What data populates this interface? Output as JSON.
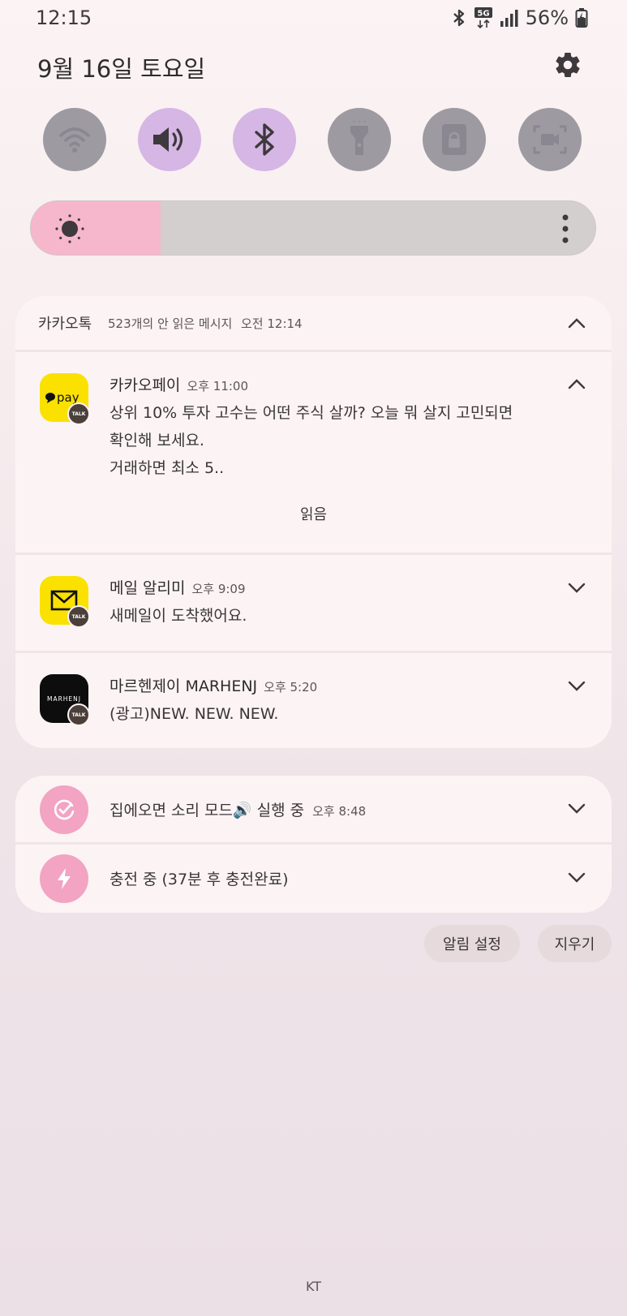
{
  "status_bar": {
    "time": "12:15",
    "network": "5G",
    "battery": "56%"
  },
  "header": {
    "date": "9월 16일 토요일"
  },
  "quick_settings": [
    {
      "name": "wifi",
      "active": false
    },
    {
      "name": "sound",
      "active": true
    },
    {
      "name": "bluetooth",
      "active": true
    },
    {
      "name": "flashlight",
      "active": false
    },
    {
      "name": "rotation-lock",
      "active": false
    },
    {
      "name": "screen-recorder",
      "active": false
    }
  ],
  "brightness": {
    "level": 0.23
  },
  "kakao_group": {
    "app_name": "카카오톡",
    "unread": "523개의 안 읽은 메시지",
    "time": "오전 12:14",
    "notifications": [
      {
        "title": "카카오페이",
        "time": "오후 11:00",
        "lines": [
          "상위 10% 투자 고수는 어떤 주식 살까? 오늘 뭐 살지 고민되면",
          "확인해 보세요.",
          "거래하면 최소 5.."
        ],
        "icon_text": "pay",
        "action": "읽음"
      },
      {
        "title": "메일 알리미",
        "time": "오후 9:09",
        "lines": [
          "새메일이 도착했어요."
        ]
      },
      {
        "title": "마르헨제이 MARHENJ",
        "time": "오후 5:20",
        "lines": [
          "(광고)NEW. NEW. NEW."
        ],
        "icon_text": "MARHENJ"
      }
    ],
    "badge_text": "TALK"
  },
  "system_group": [
    {
      "text": "집에오면 소리 모드🔊 실행 중",
      "time": "오후 8:48"
    },
    {
      "text": "충전 중 (37분 후 충전완료)",
      "time": ""
    }
  ],
  "actions": {
    "notification_settings": "알림 설정",
    "clear": "지우기"
  },
  "carrier": "KT",
  "colors": {
    "accent_active": "#d5b6e4",
    "inactive": "#9d9aa1",
    "brightness_fill": "#f6b6cc",
    "system_icon": "#f2a4c2",
    "kakao_yellow": "#fae100"
  }
}
